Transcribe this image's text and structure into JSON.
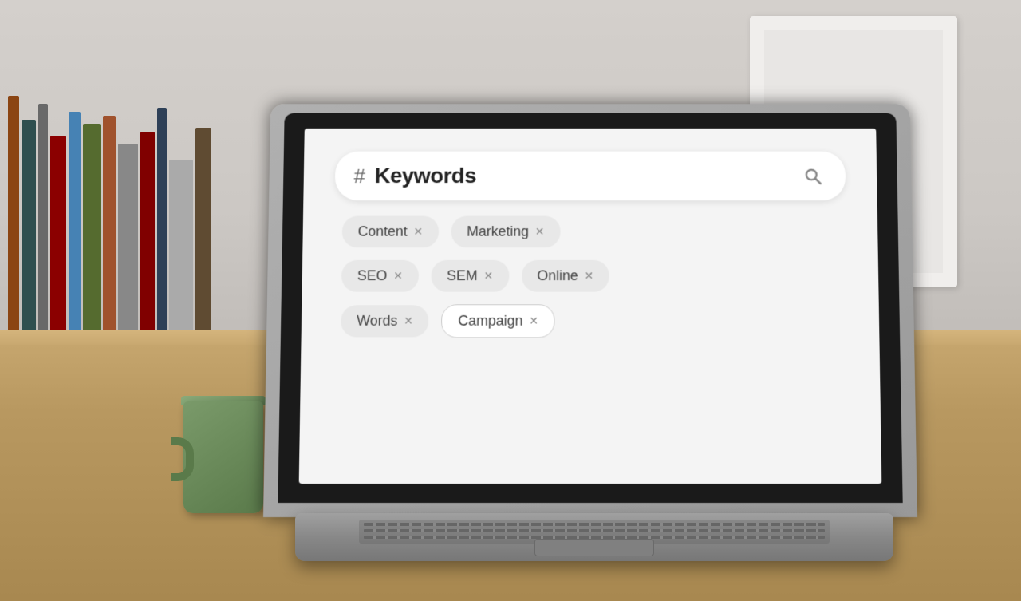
{
  "scene": {
    "title": "Keywords Search UI on Laptop"
  },
  "search": {
    "hash_symbol": "#",
    "placeholder": "Keywords",
    "search_icon": "🔍"
  },
  "tags": {
    "row1": [
      {
        "label": "Content",
        "x": "x",
        "selected": false
      },
      {
        "label": "Marketing",
        "x": "x",
        "selected": false
      }
    ],
    "row2": [
      {
        "label": "SEO",
        "x": "x",
        "selected": false
      },
      {
        "label": "SEM",
        "x": "x",
        "selected": false
      },
      {
        "label": "Online",
        "x": "x",
        "selected": false
      }
    ],
    "row3": [
      {
        "label": "Words",
        "x": "x",
        "selected": false
      },
      {
        "label": "Campaign",
        "x": "x",
        "selected": true
      }
    ]
  },
  "books": {
    "colors": [
      "#8B4513",
      "#D2691E",
      "#2F4F4F",
      "#696969",
      "#8B0000",
      "#4682B4",
      "#556B2F",
      "#A0522D",
      "#708090",
      "#800000",
      "#2E4057",
      "#5F4B32"
    ]
  }
}
